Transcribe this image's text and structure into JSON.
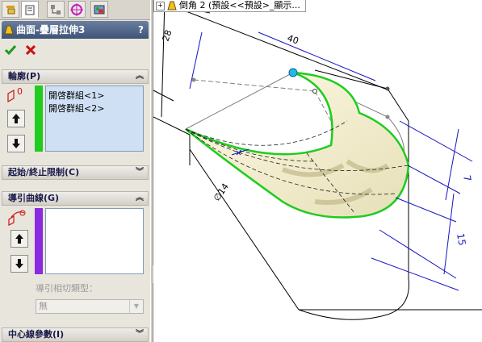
{
  "property_manager": {
    "title": "曲面-疊層拉伸3",
    "help_label": "?",
    "ok_icon": "checkmark-icon",
    "cancel_icon": "x-icon",
    "ok_color": "#1c9a1c",
    "cancel_color": "#cc1111"
  },
  "tabs": [
    {
      "icon": "feature-manager-icon"
    },
    {
      "icon": "property-manager-icon"
    },
    {
      "icon": "configuration-manager-icon"
    },
    {
      "icon": "dimxpert-icon"
    },
    {
      "icon": "display-manager-icon"
    }
  ],
  "profiles": {
    "header": "輪廓(P)",
    "items": [
      "開啓群組<1>",
      "開啓群組<2>"
    ],
    "color": "#1fcc1f"
  },
  "start_end": {
    "header": "起始/終止限制(C)"
  },
  "guides": {
    "header": "導引曲線(G)",
    "color": "#8a2be2",
    "tangency_label": "導引相切類型：",
    "tangency_value": "無"
  },
  "centerline": {
    "header": "中心線參數(I)"
  },
  "breadcrumb": {
    "text": "倒角 2 (預設<<預設>_顯示..."
  },
  "dimensions": [
    "40",
    "28",
    "∅14",
    "7",
    "15"
  ],
  "colors": {
    "panel_bg": "#e8e5dc",
    "title_bg": "#4c6286",
    "surface": "#1fcc1f",
    "dimension": "#1515c0",
    "handle": "#22b8e8"
  }
}
